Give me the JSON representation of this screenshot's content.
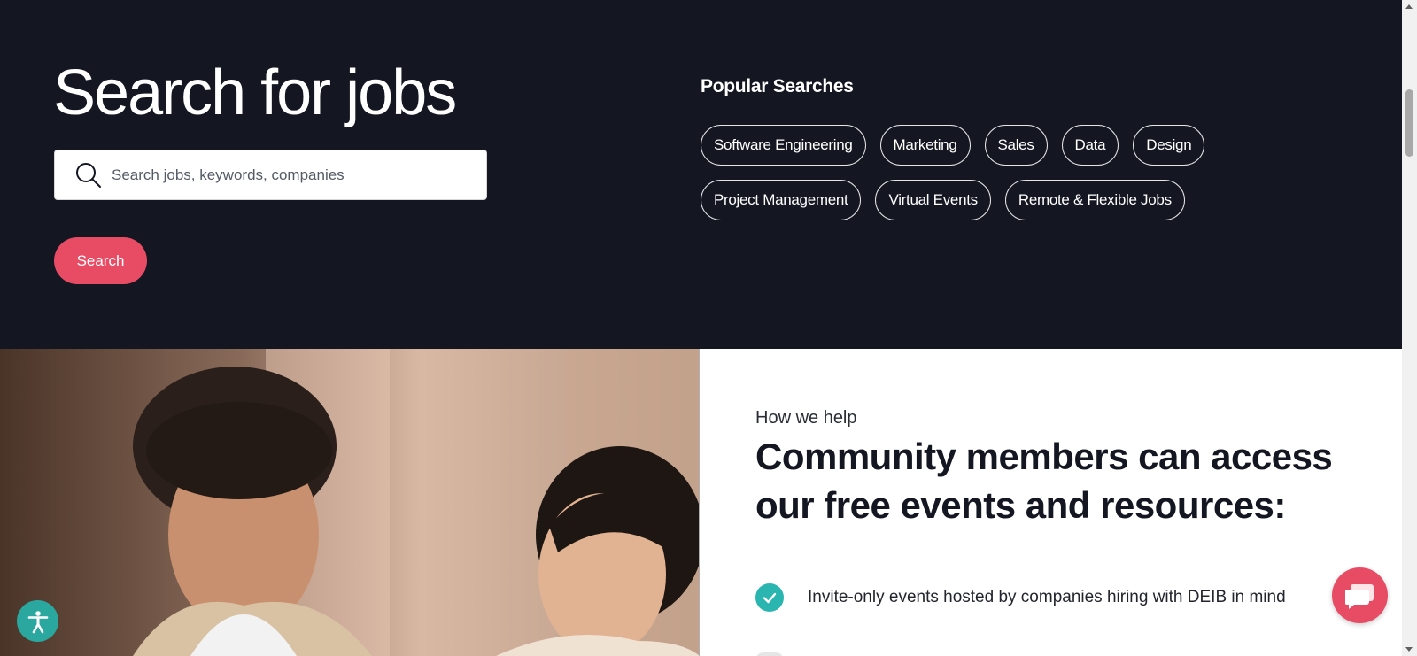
{
  "hero": {
    "title": "Search for jobs",
    "search_placeholder": "Search jobs, keywords, companies",
    "search_value": "",
    "search_button": "Search",
    "background": "#141722"
  },
  "popular": {
    "title": "Popular Searches",
    "row1": [
      "Software Engineering",
      "Marketing",
      "Sales",
      "Data",
      "Design"
    ],
    "row2": [
      "Project Management",
      "Virtual Events",
      "Remote & Flexible Jobs"
    ]
  },
  "help": {
    "eyebrow": "How we help",
    "heading": "Community members can access our free events and resources:",
    "benefits": [
      {
        "icon": "check-circle-icon",
        "text": "Invite-only events hosted by companies hiring with DEIB in mind"
      }
    ]
  },
  "widgets": {
    "accessibility_icon": "accessibility-icon",
    "chat_icon": "chat-bubble-icon"
  },
  "colors": {
    "accent": "#e84c64",
    "teal": "#2bb5b0",
    "dark": "#141722"
  }
}
